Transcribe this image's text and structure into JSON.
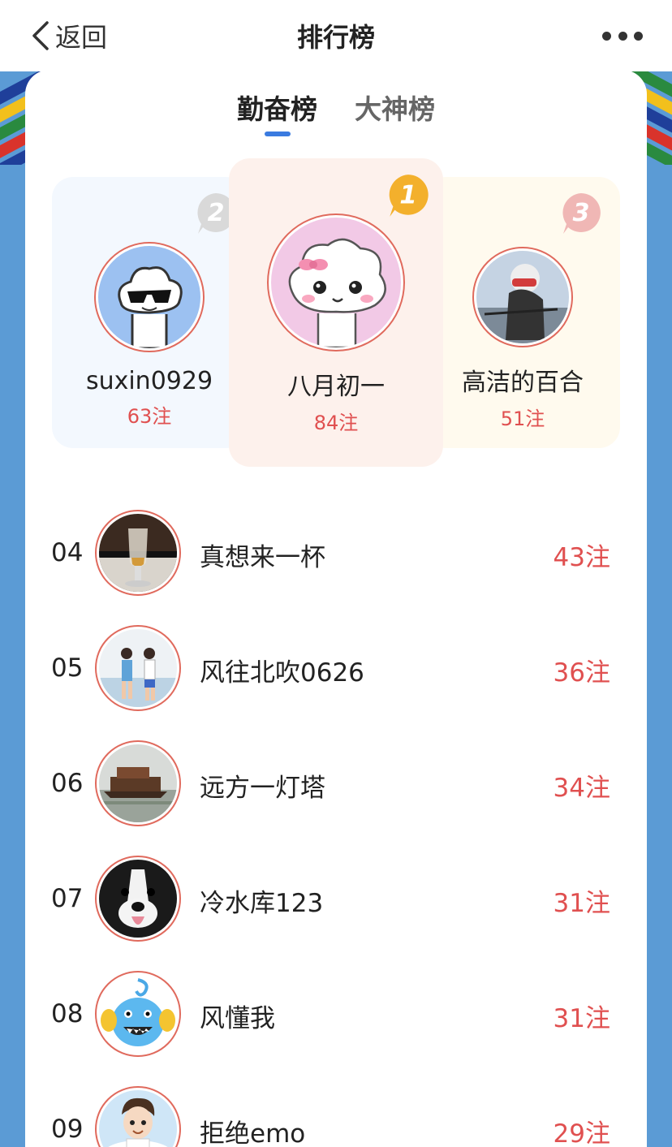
{
  "nav": {
    "back_label": "返回",
    "title": "排行榜",
    "more_icon": "more-dots-icon"
  },
  "tabs": [
    {
      "label": "勤奋榜",
      "active": true
    },
    {
      "label": "大神榜",
      "active": false
    }
  ],
  "podium": [
    {
      "rank_badge": "2",
      "name": "suxin0929",
      "count": "63注",
      "avatar": "sunglasses-cloud-avatar"
    },
    {
      "rank_badge": "1",
      "name": "八月初一",
      "count": "84注",
      "avatar": "pink-bow-cloud-avatar"
    },
    {
      "rank_badge": "3",
      "name": "高洁的百合",
      "count": "51注",
      "avatar": "cyclist-photo-avatar"
    }
  ],
  "list": [
    {
      "rank": "04",
      "name": "真想来一杯",
      "count": "43注",
      "avatar": "whisky-glass-photo"
    },
    {
      "rank": "05",
      "name": "风往北吹0626",
      "count": "36注",
      "avatar": "couple-beach-photo"
    },
    {
      "rank": "06",
      "name": "远方一灯塔",
      "count": "34注",
      "avatar": "river-boat-photo"
    },
    {
      "rank": "07",
      "name": "冷水库123",
      "count": "31注",
      "avatar": "border-collie-photo"
    },
    {
      "rank": "08",
      "name": "风懂我",
      "count": "31注",
      "avatar": "blue-monster-cartoon"
    },
    {
      "rank": "09",
      "name": "拒绝emo",
      "count": "29注",
      "avatar": "anime-boy-cartoon"
    }
  ],
  "colors": {
    "accent_blue": "#3a7be0",
    "count_red": "#e05050",
    "avatar_ring": "#e06a5d",
    "background": "#5b9bd5"
  }
}
